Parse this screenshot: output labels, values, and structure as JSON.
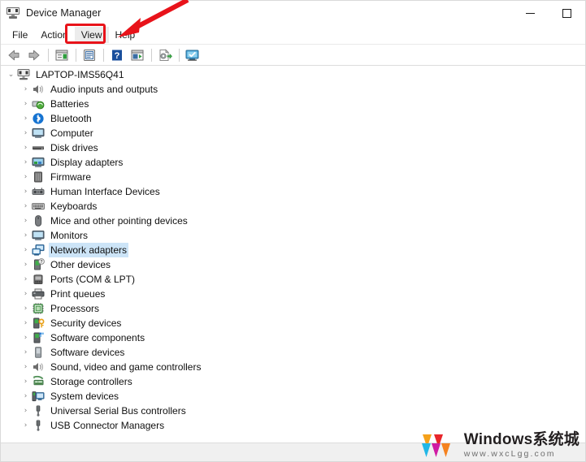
{
  "window": {
    "title": "Device Manager",
    "icon": "device-manager-icon",
    "controls": {
      "minimize": "–",
      "maximize": "□"
    }
  },
  "menubar": {
    "items": [
      {
        "label": "File",
        "highlighted": false
      },
      {
        "label": "Action",
        "highlighted": false
      },
      {
        "label": "View",
        "highlighted": true
      },
      {
        "label": "Help",
        "highlighted": false
      }
    ]
  },
  "annotation": {
    "target": "View",
    "box_color": "#e8131a",
    "arrow_color": "#e8131a"
  },
  "toolbar": {
    "buttons": [
      {
        "name": "back-button",
        "icon": "arrow-left-icon"
      },
      {
        "name": "forward-button",
        "icon": "arrow-right-icon"
      },
      {
        "name": "separator-1",
        "icon": "separator"
      },
      {
        "name": "show-hide-console-tree-button",
        "icon": "console-tree-icon"
      },
      {
        "name": "separator-2",
        "icon": "separator"
      },
      {
        "name": "properties-button",
        "icon": "properties-icon"
      },
      {
        "name": "separator-3",
        "icon": "separator"
      },
      {
        "name": "help-button",
        "icon": "help-question-icon"
      },
      {
        "name": "show-hide-action-pane-button",
        "icon": "action-pane-icon"
      },
      {
        "name": "separator-4",
        "icon": "separator"
      },
      {
        "name": "update-driver-button",
        "icon": "update-driver-icon"
      },
      {
        "name": "separator-5",
        "icon": "separator"
      },
      {
        "name": "scan-hardware-changes-button",
        "icon": "scan-hardware-icon"
      }
    ]
  },
  "tree": {
    "root": {
      "label": "LAPTOP-IMS56Q41",
      "icon": "computer-node-icon",
      "expanded": true,
      "chevron": "⌄"
    },
    "items": [
      {
        "label": "Audio inputs and outputs",
        "icon": "speaker-icon",
        "selected": false
      },
      {
        "label": "Batteries",
        "icon": "battery-icon",
        "selected": false
      },
      {
        "label": "Bluetooth",
        "icon": "bluetooth-icon",
        "selected": false
      },
      {
        "label": "Computer",
        "icon": "monitor-icon",
        "selected": false
      },
      {
        "label": "Disk drives",
        "icon": "disk-drive-icon",
        "selected": false
      },
      {
        "label": "Display adapters",
        "icon": "display-adapter-icon",
        "selected": false
      },
      {
        "label": "Firmware",
        "icon": "firmware-chip-icon",
        "selected": false
      },
      {
        "label": "Human Interface Devices",
        "icon": "hid-icon",
        "selected": false
      },
      {
        "label": "Keyboards",
        "icon": "keyboard-icon",
        "selected": false
      },
      {
        "label": "Mice and other pointing devices",
        "icon": "mouse-icon",
        "selected": false
      },
      {
        "label": "Monitors",
        "icon": "monitor-icon",
        "selected": false
      },
      {
        "label": "Network adapters",
        "icon": "network-adapter-icon",
        "selected": true
      },
      {
        "label": "Other devices",
        "icon": "other-device-question-icon",
        "selected": false
      },
      {
        "label": "Ports (COM & LPT)",
        "icon": "port-icon",
        "selected": false
      },
      {
        "label": "Print queues",
        "icon": "printer-icon",
        "selected": false
      },
      {
        "label": "Processors",
        "icon": "processor-icon",
        "selected": false
      },
      {
        "label": "Security devices",
        "icon": "security-key-icon",
        "selected": false
      },
      {
        "label": "Software components",
        "icon": "software-component-icon",
        "selected": false
      },
      {
        "label": "Software devices",
        "icon": "software-device-icon",
        "selected": false
      },
      {
        "label": "Sound, video and game controllers",
        "icon": "speaker-icon",
        "selected": false
      },
      {
        "label": "Storage controllers",
        "icon": "storage-controller-icon",
        "selected": false
      },
      {
        "label": "System devices",
        "icon": "system-device-icon",
        "selected": false
      },
      {
        "label": "Universal Serial Bus controllers",
        "icon": "usb-icon",
        "selected": false
      },
      {
        "label": "USB Connector Managers",
        "icon": "usb-icon",
        "selected": false
      }
    ],
    "child_chevron": "›",
    "selection_color": "#cce4f7"
  },
  "watermark": {
    "title": "Windows系统城",
    "url": "www.wxcLgg.com",
    "logo_colors": [
      "#f5a11b",
      "#e8262b",
      "#22b7e6",
      "#cf1ba4",
      "#f5821f"
    ]
  }
}
